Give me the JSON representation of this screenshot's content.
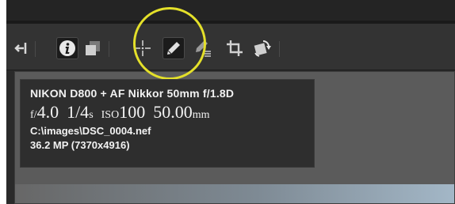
{
  "toolbar": {
    "icons": [
      {
        "name": "dock-left-icon"
      },
      {
        "name": "info-icon",
        "active": true
      },
      {
        "name": "compare-icon"
      },
      {
        "name": "crosshair-icon"
      },
      {
        "name": "pencil-icon",
        "active": true
      },
      {
        "name": "pencil-list-icon"
      },
      {
        "name": "crop-icon"
      },
      {
        "name": "rotate-icon"
      }
    ],
    "highlight_color": "#e4e02a"
  },
  "info_panel": {
    "camera": "NIKON D800 + AF Nikkor 50mm f/1.8D",
    "aperture_prefix": "f/",
    "aperture_value": "4.0",
    "shutter_value": "1/4",
    "shutter_unit": "s",
    "iso_prefix": "ISO",
    "iso_value": "100",
    "focal_value": "50.00",
    "focal_unit": "mm",
    "path": "C:\\images\\DSC_0004.nef",
    "megapixels": "36.2 MP (7370x4916)"
  }
}
